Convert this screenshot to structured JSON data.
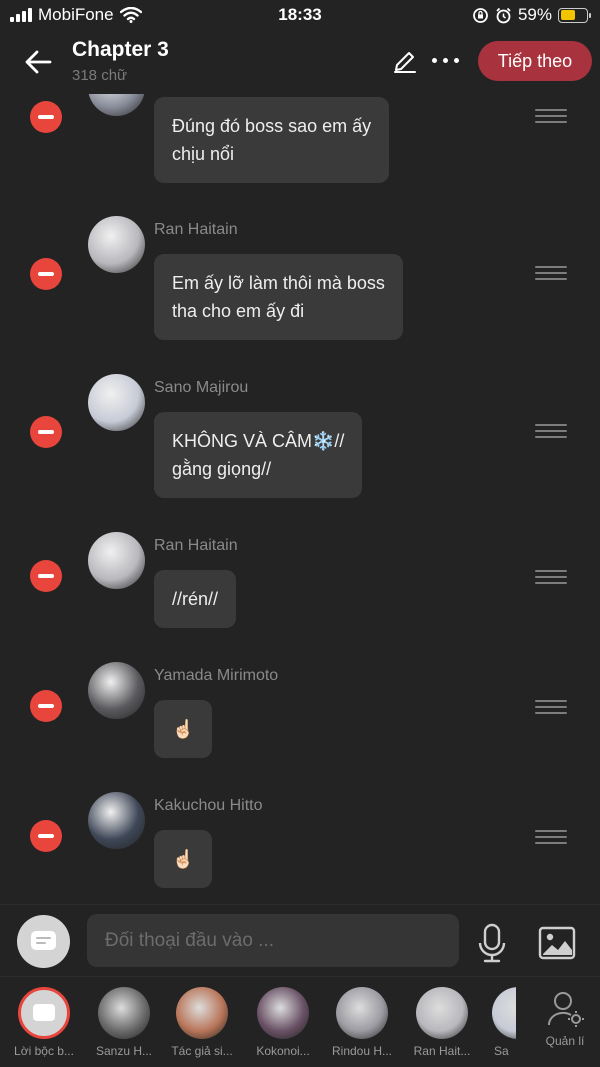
{
  "status": {
    "carrier": "MobiFone",
    "time": "18:33",
    "battery_percent": "59%",
    "battery_level": 0.59,
    "icons": [
      "signal-icon",
      "wifi-icon",
      "rotation-lock-icon",
      "alarm-icon",
      "battery-icon"
    ]
  },
  "header": {
    "title": "Chapter 3",
    "subtitle": "318 chữ",
    "next_label": "Tiếp theo",
    "icons": [
      "back-arrow-icon",
      "pencil-icon",
      "more-icon"
    ]
  },
  "messages": [
    {
      "name": "",
      "lines": [
        "Đúng đó boss sao em ấy",
        "chịu nổi"
      ],
      "avatar_color": "#8a8f9c"
    },
    {
      "name": "Ran Haitain",
      "lines": [
        "Em ấy lỡ làm thôi mà boss",
        "tha cho em ấy đi"
      ],
      "avatar_color": "#b8b8bd"
    },
    {
      "name": "Sano Majirou",
      "lines": [
        "KHÔNG VÀ CÂM❄️//",
        "gằng giọng//"
      ],
      "avatar_color": "#c7cbd6"
    },
    {
      "name": "Ran Haitain",
      "lines": [
        "//rén//"
      ],
      "avatar_color": "#b8b8bd"
    },
    {
      "name": "Yamada Mirimoto",
      "lines": [
        "☝🏻"
      ],
      "avatar_color": "#5a5a5e"
    },
    {
      "name": "Kakuchou Hitto",
      "lines": [
        "☝🏻"
      ],
      "avatar_color": "#3e4757"
    }
  ],
  "composer": {
    "placeholder": "Đối thoại đầu vào ...",
    "icons": [
      "narration-icon",
      "microphone-icon",
      "image-icon"
    ]
  },
  "characters": [
    {
      "label": "Lời bộc b...",
      "selected": true
    },
    {
      "label": "Sanzu H...",
      "color": "#6b6b6b"
    },
    {
      "label": "Tác giả si...",
      "color": "#b9765a"
    },
    {
      "label": "Kokonoi...",
      "color": "#6a5266"
    },
    {
      "label": "Rindou H...",
      "color": "#9b9ba2"
    },
    {
      "label": "Ran Hait...",
      "color": "#b8b8bd"
    },
    {
      "label": "Sa",
      "color": "#c7cbd6"
    }
  ],
  "manage_label": "Quản lí",
  "colors": {
    "accent": "#a8333e",
    "delete": "#e8453c",
    "background": "#232323",
    "bubble": "#3a3a3a"
  }
}
